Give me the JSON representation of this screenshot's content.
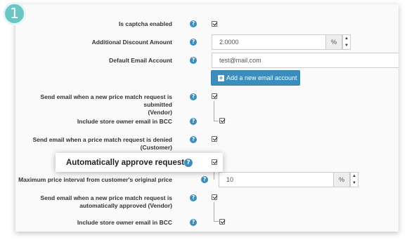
{
  "step_number": "1",
  "fields": {
    "captcha_label": "Is captcha enabled",
    "discount_label": "Additional Discount Amount",
    "discount_value": "2.0000",
    "discount_unit": "%",
    "email_account_label": "Default Email Account",
    "email_account_value": "test@mail.com",
    "add_email_button": "Add a new email account",
    "submitted_label_line1": "Send email when a new price match request is submitted",
    "submitted_label_line2": "(Vendor)",
    "bcc_label_1": "Include store owner email in BCC",
    "denied_label_line1": "Send email when a price match request is denied",
    "denied_label_line2": "(Customer)",
    "auto_approve_label": "Automatically approve requests",
    "max_interval_label": "Maximum price interval from customer's original price",
    "max_interval_value": "10",
    "max_interval_unit": "%",
    "auto_approved_label_line1": "Send email when a new price match request is",
    "auto_approved_label_line2": "automatically approved (Vendor)",
    "bcc_label_2": "Include store owner email in BCC"
  },
  "help_glyph": "?",
  "colors": {
    "accent": "#3c8dbc",
    "badge": "#6dc6c6"
  }
}
